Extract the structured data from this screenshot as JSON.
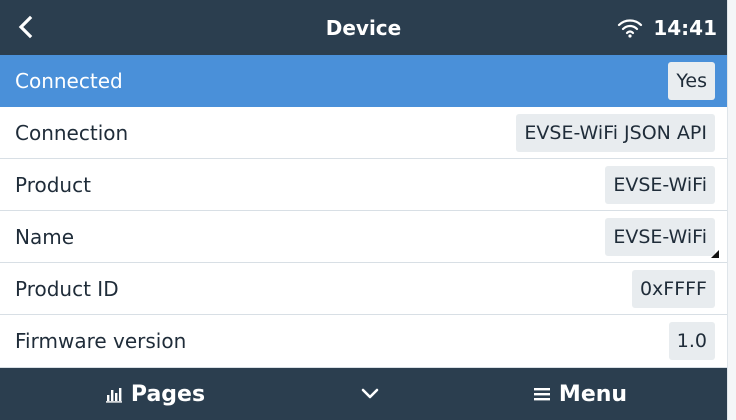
{
  "header": {
    "back_icon": "chevron-left-icon",
    "title": "Device",
    "wifi_icon": "wifi-icon",
    "time": "14:41"
  },
  "rows": [
    {
      "label": "Connected",
      "value": "Yes",
      "selected": true
    },
    {
      "label": "Connection",
      "value": "EVSE-WiFi JSON API",
      "selected": false
    },
    {
      "label": "Product",
      "value": "EVSE-WiFi",
      "selected": false
    },
    {
      "label": "Name",
      "value": "EVSE-WiFi",
      "selected": false,
      "editable_marker": true
    },
    {
      "label": "Product ID",
      "value": "0xFFFF",
      "selected": false
    },
    {
      "label": "Firmware version",
      "value": "1.0",
      "selected": false
    }
  ],
  "footer": {
    "pages_icon": "bar-chart-icon",
    "pages_label": "Pages",
    "chevron_icon": "chevron-down-icon",
    "menu_icon": "hamburger-menu-icon",
    "menu_label": "Menu"
  },
  "colors": {
    "header_bg": "#2b3e4f",
    "selected_row": "#4a90d9",
    "value_bg": "#e8ecef"
  }
}
